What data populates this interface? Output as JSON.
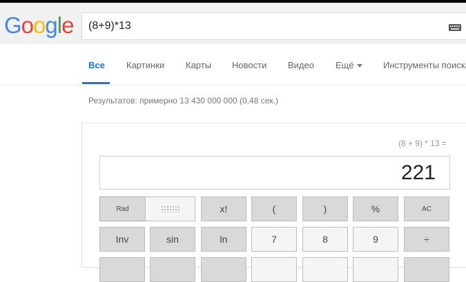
{
  "header": {
    "logo_text": "Google",
    "logo_colors": [
      "#4285F4",
      "#EA4335",
      "#FBBC05",
      "#4285F4",
      "#34A853",
      "#EA4335"
    ],
    "search_value": "(8+9)*13",
    "keyboard_icon": "keyboard-icon"
  },
  "tabs": [
    {
      "label": "Все",
      "active": true
    },
    {
      "label": "Картинки"
    },
    {
      "label": "Карты"
    },
    {
      "label": "Новости"
    },
    {
      "label": "Видео"
    },
    {
      "label": "Ещё"
    },
    {
      "label": "Инструменты поиска"
    }
  ],
  "results_stats": "Результатов: примерно 13 430 000 000 (0,48 сек.)",
  "calculator": {
    "history": "(8 + 9) * 13 =",
    "result": "221",
    "row1": [
      "Rad",
      "x!",
      "(",
      ")",
      "%",
      "AC"
    ],
    "row2": [
      "Inv",
      "sin",
      "ln",
      "7",
      "8",
      "9",
      "÷"
    ]
  },
  "colors": {
    "accent": "#1a73e8",
    "header_bg": "#f1f1f1",
    "dark_button": "#d9d9d9",
    "light_button": "#f5f5f5"
  }
}
